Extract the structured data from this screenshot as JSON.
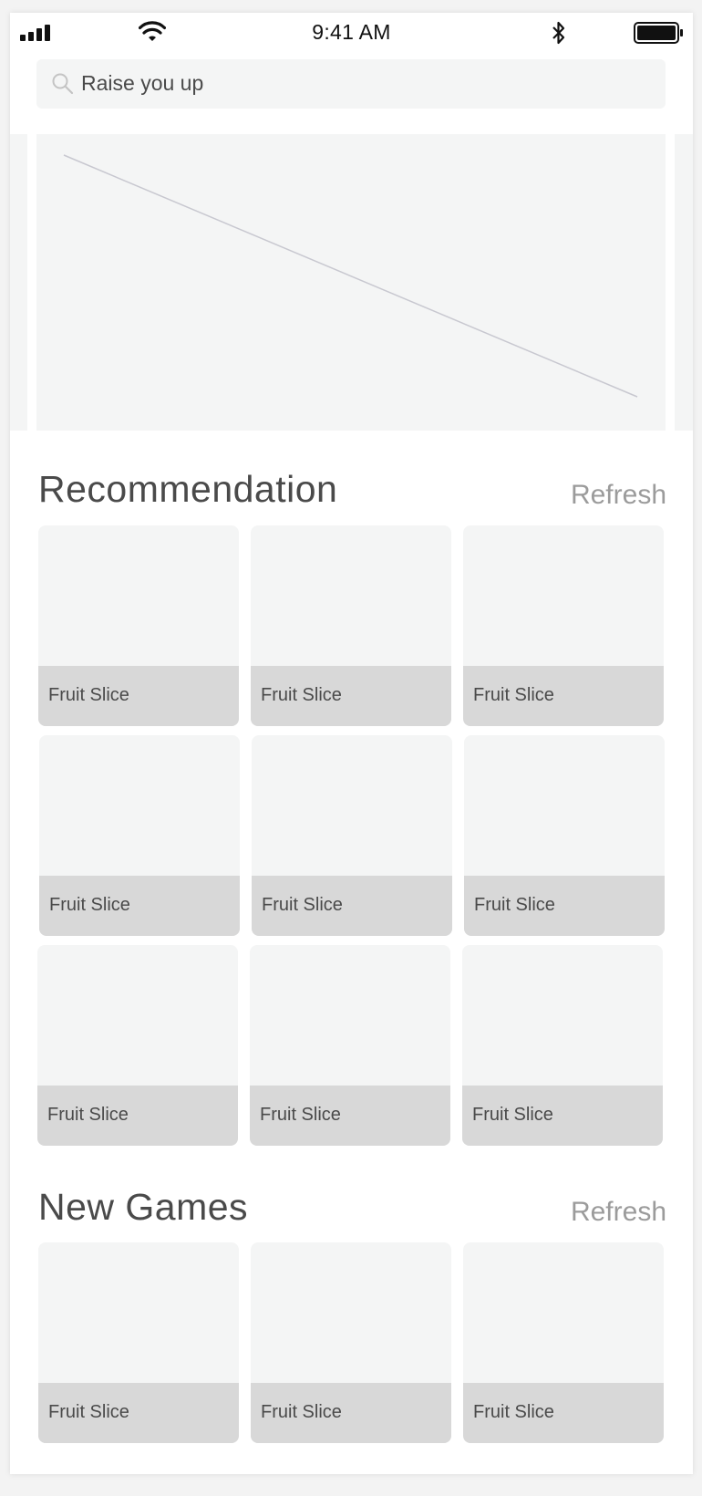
{
  "status_bar": {
    "time": "9:41 AM"
  },
  "search": {
    "query": "Raise you up"
  },
  "recommendation": {
    "title": "Recommendation",
    "refresh_label": "Refresh",
    "games": [
      {
        "label": "Fruit Slice"
      },
      {
        "label": "Fruit Slice"
      },
      {
        "label": "Fruit Slice"
      },
      {
        "label": "Fruit Slice"
      },
      {
        "label": "Fruit Slice"
      },
      {
        "label": "Fruit Slice"
      },
      {
        "label": "Fruit Slice"
      },
      {
        "label": "Fruit Slice"
      },
      {
        "label": "Fruit Slice"
      }
    ]
  },
  "new_games": {
    "title": "New Games",
    "refresh_label": "Refresh",
    "games": [
      {
        "label": "Fruit Slice"
      },
      {
        "label": "Fruit Slice"
      },
      {
        "label": "Fruit Slice"
      }
    ]
  },
  "colors": {
    "placeholder_fill": "#f4f5f5",
    "label_bar": "#d8d8d8",
    "text": "#4a4a4a",
    "refresh": "#9b9b9b"
  },
  "icons": [
    "signal-icon",
    "wifi-icon",
    "bluetooth-icon",
    "battery-icon",
    "search-icon"
  ]
}
